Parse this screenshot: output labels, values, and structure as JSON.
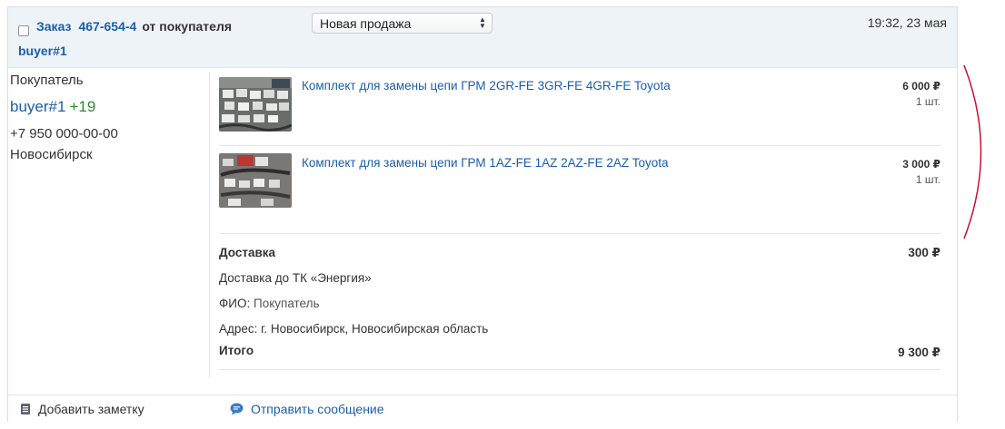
{
  "header": {
    "order_word": "Заказ",
    "order_number": "467-654-4",
    "from_buyer": "от покупателя",
    "buyer_link": "buyer#1",
    "status_selected": "Новая продажа",
    "time": "19:32, 23 мая"
  },
  "buyer": {
    "label": "Покупатель",
    "name": "buyer#1",
    "rating": "+19",
    "phone": "+7 950 000-00-00",
    "city": "Новосибирск"
  },
  "products": [
    {
      "title": "Комплект для замены цепи ГРМ 2GR-FE 3GR-FE 4GR-FE Toyota",
      "price": "6 000 ₽",
      "qty": "1 шт."
    },
    {
      "title": "Комплект для замены цепи ГРМ 1AZ-FE 1AZ 2AZ-FE 2AZ Toyota",
      "price": "3 000 ₽",
      "qty": "1 шт."
    }
  ],
  "delivery": {
    "label": "Доставка",
    "price": "300 ₽",
    "method": "Доставка до ТК «Энергия»",
    "fio_label": "ФИО:",
    "fio_value": "Покупатель",
    "address": "Адрес: г. Новосибирск, Новосибирская область"
  },
  "total": {
    "label": "Итого",
    "value": "9 300 ₽"
  },
  "footer": {
    "add_note": "Добавить заметку",
    "send_message": "Отправить сообщение"
  },
  "icons": {
    "note": "note-icon",
    "message": "chat-bubble-icon",
    "select_arrows": "select-arrows-icon"
  },
  "colors": {
    "link": "#1a5eae",
    "rating": "#2e8b2e",
    "header_bg": "#eef3f7",
    "annotation": "#c8102e"
  }
}
